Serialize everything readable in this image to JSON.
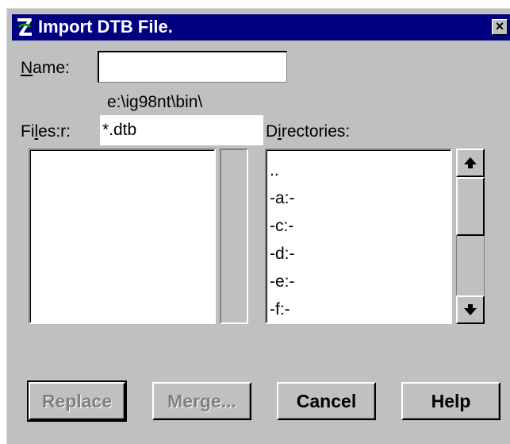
{
  "window": {
    "title": "Import DTB File.",
    "close_label": "×"
  },
  "name_field": {
    "label_key": "N",
    "label_rest": "ame:",
    "value": ""
  },
  "current_path": "e:\\ig98nt\\bin\\",
  "files_filter": {
    "label_pre": "Fi",
    "label_key": "l",
    "label_rest": "es:r:",
    "value": "*.dtb"
  },
  "directories": {
    "label_pre": "D",
    "label_key": "i",
    "label_rest": "rectories:",
    "items": [
      "..",
      "-a:-",
      "-c:-",
      "-d:-",
      "-e:-",
      "-f:-"
    ]
  },
  "buttons": {
    "replace": "Replace",
    "merge": "Merge...",
    "cancel": "Cancel",
    "help": "Help"
  }
}
